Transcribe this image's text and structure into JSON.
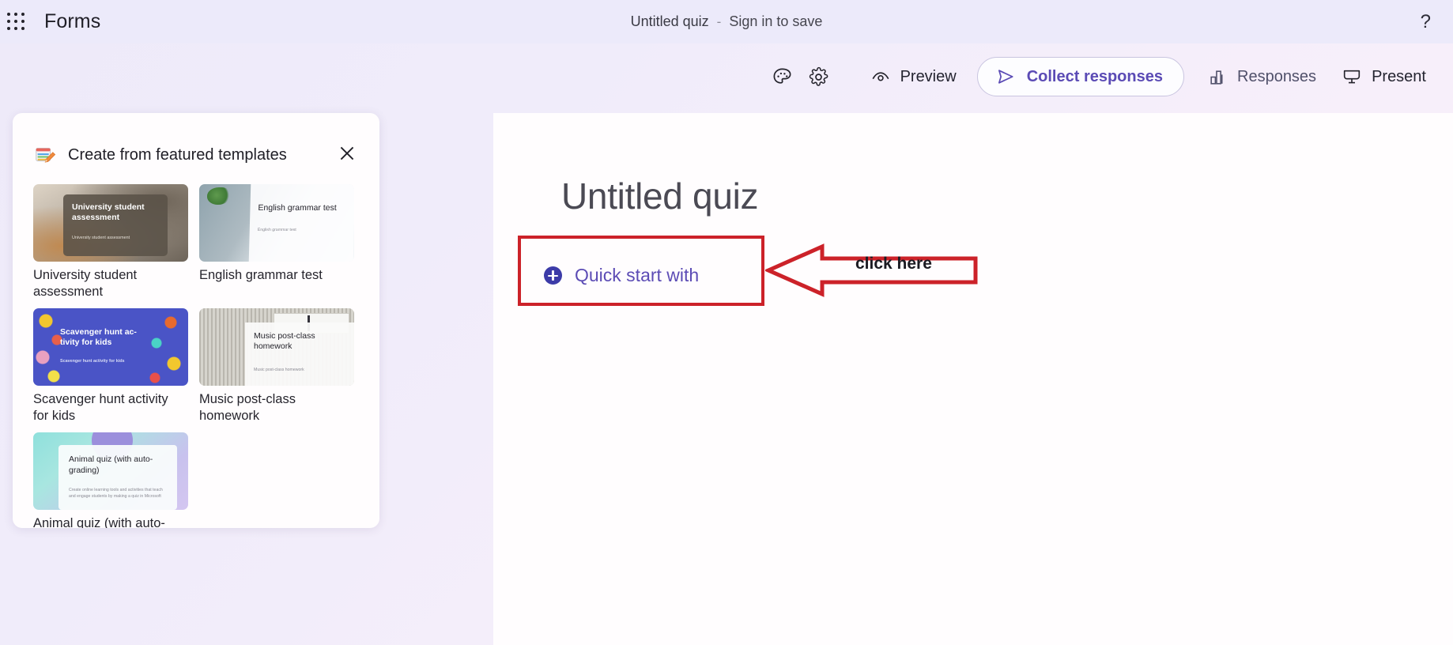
{
  "header": {
    "app_launcher_icon": "waffle-grid-icon",
    "brand": "Forms",
    "doc_title": "Untitled quiz",
    "separator": "-",
    "signin_label": "Sign in to save",
    "help_icon": "?"
  },
  "toolbar": {
    "theme_icon": "palette-icon",
    "settings_icon": "gear-icon",
    "preview_label": "Preview",
    "preview_icon": "eye-icon",
    "collect_label": "Collect responses",
    "collect_icon": "send-icon",
    "responses_label": "Responses",
    "responses_icon": "bar-chart-icon",
    "present_label": "Present",
    "present_icon": "present-screen-icon"
  },
  "templates_panel": {
    "header_icon": "notebook-pencil-icon",
    "title": "Create from featured templates",
    "close_icon": "close-x-icon",
    "cards": [
      {
        "label": "University student assessment",
        "thumb_title": "University student assessment",
        "thumb_sub": "University student assessment"
      },
      {
        "label": "English grammar test",
        "thumb_title": "English grammar test",
        "thumb_sub": "English grammar test"
      },
      {
        "label": "Scavenger hunt activity for kids",
        "thumb_title": "Scavenger hunt ac-tivity for kids",
        "thumb_sub": "Scavenger hunt activity for kids"
      },
      {
        "label": "Music post-class homework",
        "thumb_title": "Music post-class homework",
        "thumb_sub": "Music post-class homework"
      },
      {
        "label": "Animal quiz (with auto-grading)",
        "thumb_title": "Animal quiz (with auto-grading)",
        "thumb_sub": "Create online learning tools and activities that teach and engage students by making a quiz in Microsoft"
      }
    ]
  },
  "canvas": {
    "quiz_title": "Untitled quiz",
    "quick_start_label": "Quick start with",
    "quick_start_icon": "plus-circle-icon"
  },
  "annotations": {
    "callout_text": "click here",
    "arrow_icon": "arrow-left-outline-icon",
    "color": "#cc2229"
  },
  "colors": {
    "accent_purple": "#5c4cb5",
    "brand_blue": "#3c3ba8",
    "header_bg": "#eceafa",
    "canvas_bg": "#fffdfe",
    "annotation_red": "#cc2229"
  }
}
